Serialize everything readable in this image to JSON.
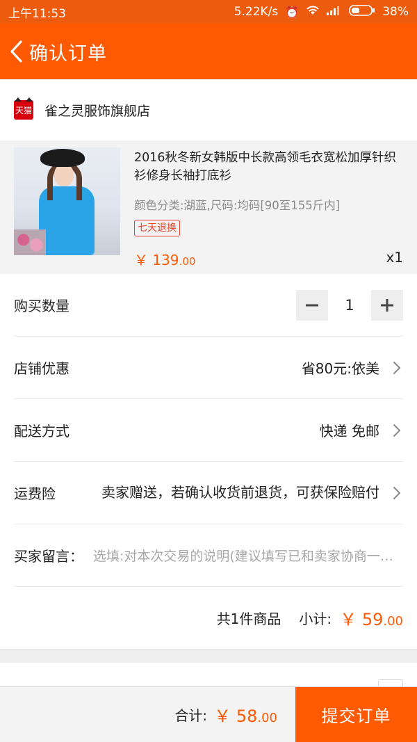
{
  "status_bar": {
    "time": "上午11:53",
    "speed": "5.22K/s",
    "battery": "38%",
    "icons": [
      "alarm-icon",
      "wifi-icon",
      "signal-icon",
      "battery-icon"
    ]
  },
  "header": {
    "title": "确认订单",
    "back_icon": "chevron-left-icon",
    "background_color": "#fe5a03"
  },
  "shop": {
    "logo_text": "天猫",
    "name": "雀之灵服饰旗舰店"
  },
  "product": {
    "title": "2016秋冬新女韩版中长款高领毛衣宽松加厚针织衫修身长袖打底衫",
    "spec": "颜色分类:湖蓝,尺码:均码[90至155斤内]",
    "tag": "七天退换",
    "price_currency": "￥",
    "price_int": "139",
    "price_dec": ".00",
    "quantity": "x1"
  },
  "rows": {
    "quantity": {
      "label": "购买数量",
      "value": "1",
      "minus_icon": "minus-icon",
      "plus_icon": "plus-icon"
    },
    "discount": {
      "label": "店铺优惠",
      "value": "省80元:依美"
    },
    "shipping": {
      "label": "配送方式",
      "value": "快递 免邮"
    },
    "insurance": {
      "label": "运费险",
      "value": "卖家赠送，若确认收货前退货，可获保险赔付"
    },
    "message": {
      "label": "买家留言：",
      "placeholder": "选填:对本次交易的说明(建议填写已和卖家协商一致的内容)"
    }
  },
  "subtotal": {
    "count": "共1件商品",
    "label": "小计:",
    "currency": "￥",
    "amount_int": "59",
    "amount_dec": ".00"
  },
  "bottom_bar": {
    "total_label": "合计:",
    "currency": "￥",
    "amount_int": "58",
    "amount_dec": ".00",
    "submit_label": "提交订单"
  },
  "colors": {
    "accent": "#fe5a03",
    "tag_red": "#e73f2b"
  }
}
